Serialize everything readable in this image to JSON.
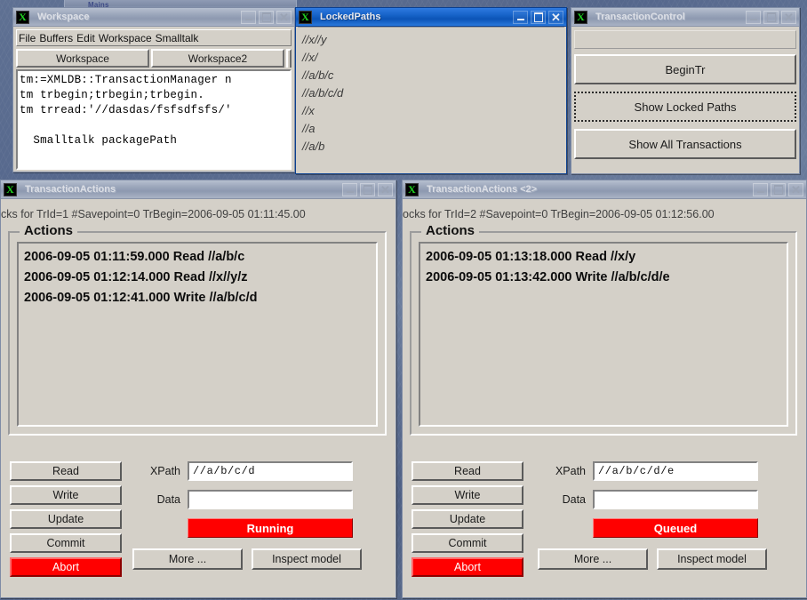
{
  "desktop": {
    "ghost_window_label": "Mains"
  },
  "windows": {
    "workspace": {
      "title": "Workspace",
      "icon": "x-app-icon",
      "titlebar_buttons": [
        "minimize",
        "maximize",
        "close"
      ],
      "menu": [
        "File",
        "Buffers",
        "Edit",
        "Workspace",
        "Smalltalk"
      ],
      "tabs": [
        "Workspace",
        "Workspace2"
      ],
      "editor_text": "tm:=XMLDB::TransactionManager n\ntm trbegin;trbegin;trbegin.\ntm trread:'//dasdas/fsfsdfsfs/'\n\n  Smalltalk packagePath"
    },
    "lockedpaths": {
      "title": "LockedPaths",
      "icon": "x-app-icon",
      "active": true,
      "paths": [
        "//x//y",
        "//x/",
        "//a/b/c",
        "//a/b/c/d",
        "//x",
        "//a",
        "//a/b"
      ]
    },
    "transactioncontrol": {
      "title": "TransactionControl",
      "icon": "x-app-icon",
      "buttons": [
        {
          "label": "BeginTr",
          "focused": false
        },
        {
          "label": "Show Locked Paths",
          "focused": true
        },
        {
          "label": "Show All Transactions",
          "focused": false
        }
      ]
    },
    "transactionactions1": {
      "title": "TransactionActions",
      "icon": "x-app-icon",
      "statusline": "cks for TrId=1 #Savepoint=0 TrBegin=2006-09-05 01:11:45.00",
      "group_label": "Actions",
      "actions": [
        "2006-09-05 01:11:59.000 Read //a/b/c",
        "2006-09-05 01:12:14.000 Read //x//y/z",
        "2006-09-05 01:12:41.000 Write //a/b/c/d"
      ],
      "action_buttons": [
        "Read",
        "Write",
        "Update",
        "Commit"
      ],
      "abort_label": "Abort",
      "xpath_label": "XPath",
      "xpath_value": "//a/b/c/d",
      "data_label": "Data",
      "data_value": "",
      "status_badge": "Running",
      "status_color": "#ff0000",
      "more_label": "More ...",
      "inspect_label": "Inspect model"
    },
    "transactionactions2": {
      "title": "TransactionActions <2>",
      "icon": "x-app-icon",
      "statusline": "ocks for TrId=2 #Savepoint=0 TrBegin=2006-09-05 01:12:56.00",
      "group_label": "Actions",
      "actions": [
        "2006-09-05 01:13:18.000 Read //x/y",
        "2006-09-05 01:13:42.000 Write //a/b/c/d/e"
      ],
      "action_buttons": [
        "Read",
        "Write",
        "Update",
        "Commit"
      ],
      "abort_label": "Abort",
      "xpath_label": "XPath",
      "xpath_value": "//a/b/c/d/e",
      "data_label": "Data",
      "data_value": "",
      "status_badge": "Queued",
      "status_color": "#ff0000",
      "more_label": "More ...",
      "inspect_label": "Inspect model"
    }
  },
  "icons": {
    "app": "X",
    "minimize": "_",
    "maximize": "□",
    "close": "✕"
  }
}
